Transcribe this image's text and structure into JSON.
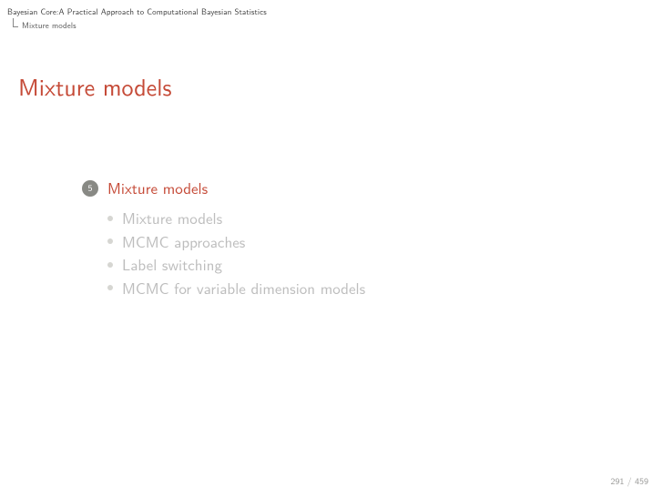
{
  "header": {
    "title": "Bayesian Core:A Practical Approach to Computational Bayesian Statistics",
    "breadcrumb": "Mixture models"
  },
  "slide": {
    "title": "Mixture models"
  },
  "section": {
    "number": "5",
    "title": "Mixture models",
    "items": [
      "Mixture models",
      "MCMC approaches",
      "Label switching",
      "MCMC for variable dimension models"
    ]
  },
  "footer": {
    "page": "291 / 459"
  }
}
